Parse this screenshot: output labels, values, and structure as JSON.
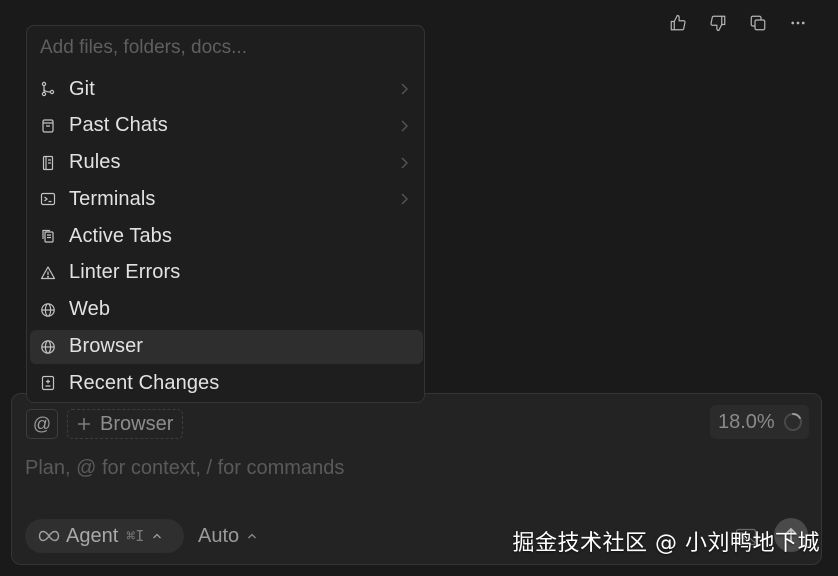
{
  "toolbar": {
    "icons": [
      "thumbs-up-icon",
      "thumbs-down-icon",
      "copy-icon",
      "more-icon"
    ]
  },
  "menu": {
    "search_placeholder": "Add files, folders, docs...",
    "items": [
      {
        "label": "Git",
        "icon": "git-branch-icon",
        "has_submenu": true
      },
      {
        "label": "Past Chats",
        "icon": "past-chats-icon",
        "has_submenu": true
      },
      {
        "label": "Rules",
        "icon": "rules-icon",
        "has_submenu": true
      },
      {
        "label": "Terminals",
        "icon": "terminal-icon",
        "has_submenu": true
      },
      {
        "label": "Active Tabs",
        "icon": "active-tabs-icon",
        "has_submenu": false
      },
      {
        "label": "Linter Errors",
        "icon": "warning-icon",
        "has_submenu": false
      },
      {
        "label": "Web",
        "icon": "globe-icon",
        "has_submenu": false
      },
      {
        "label": "Browser",
        "icon": "globe-icon",
        "has_submenu": false,
        "selected": true
      },
      {
        "label": "Recent Changes",
        "icon": "recent-changes-icon",
        "has_submenu": false
      }
    ]
  },
  "composer": {
    "at_label": "@",
    "context_chip": "Browser",
    "context_usage": "18.0%",
    "placeholder": "Plan, @ for context, / for commands",
    "agent_label": "Agent",
    "agent_shortcut": "⌘I",
    "model_label": "Auto"
  },
  "watermark": "掘金技术社区 @ 小刘鸭地下城",
  "colors": {
    "background": "#1a1a1a",
    "menu_bg": "#1e1e1e",
    "selected_bg": "#2e2e2e",
    "panel_bg": "#232323"
  }
}
